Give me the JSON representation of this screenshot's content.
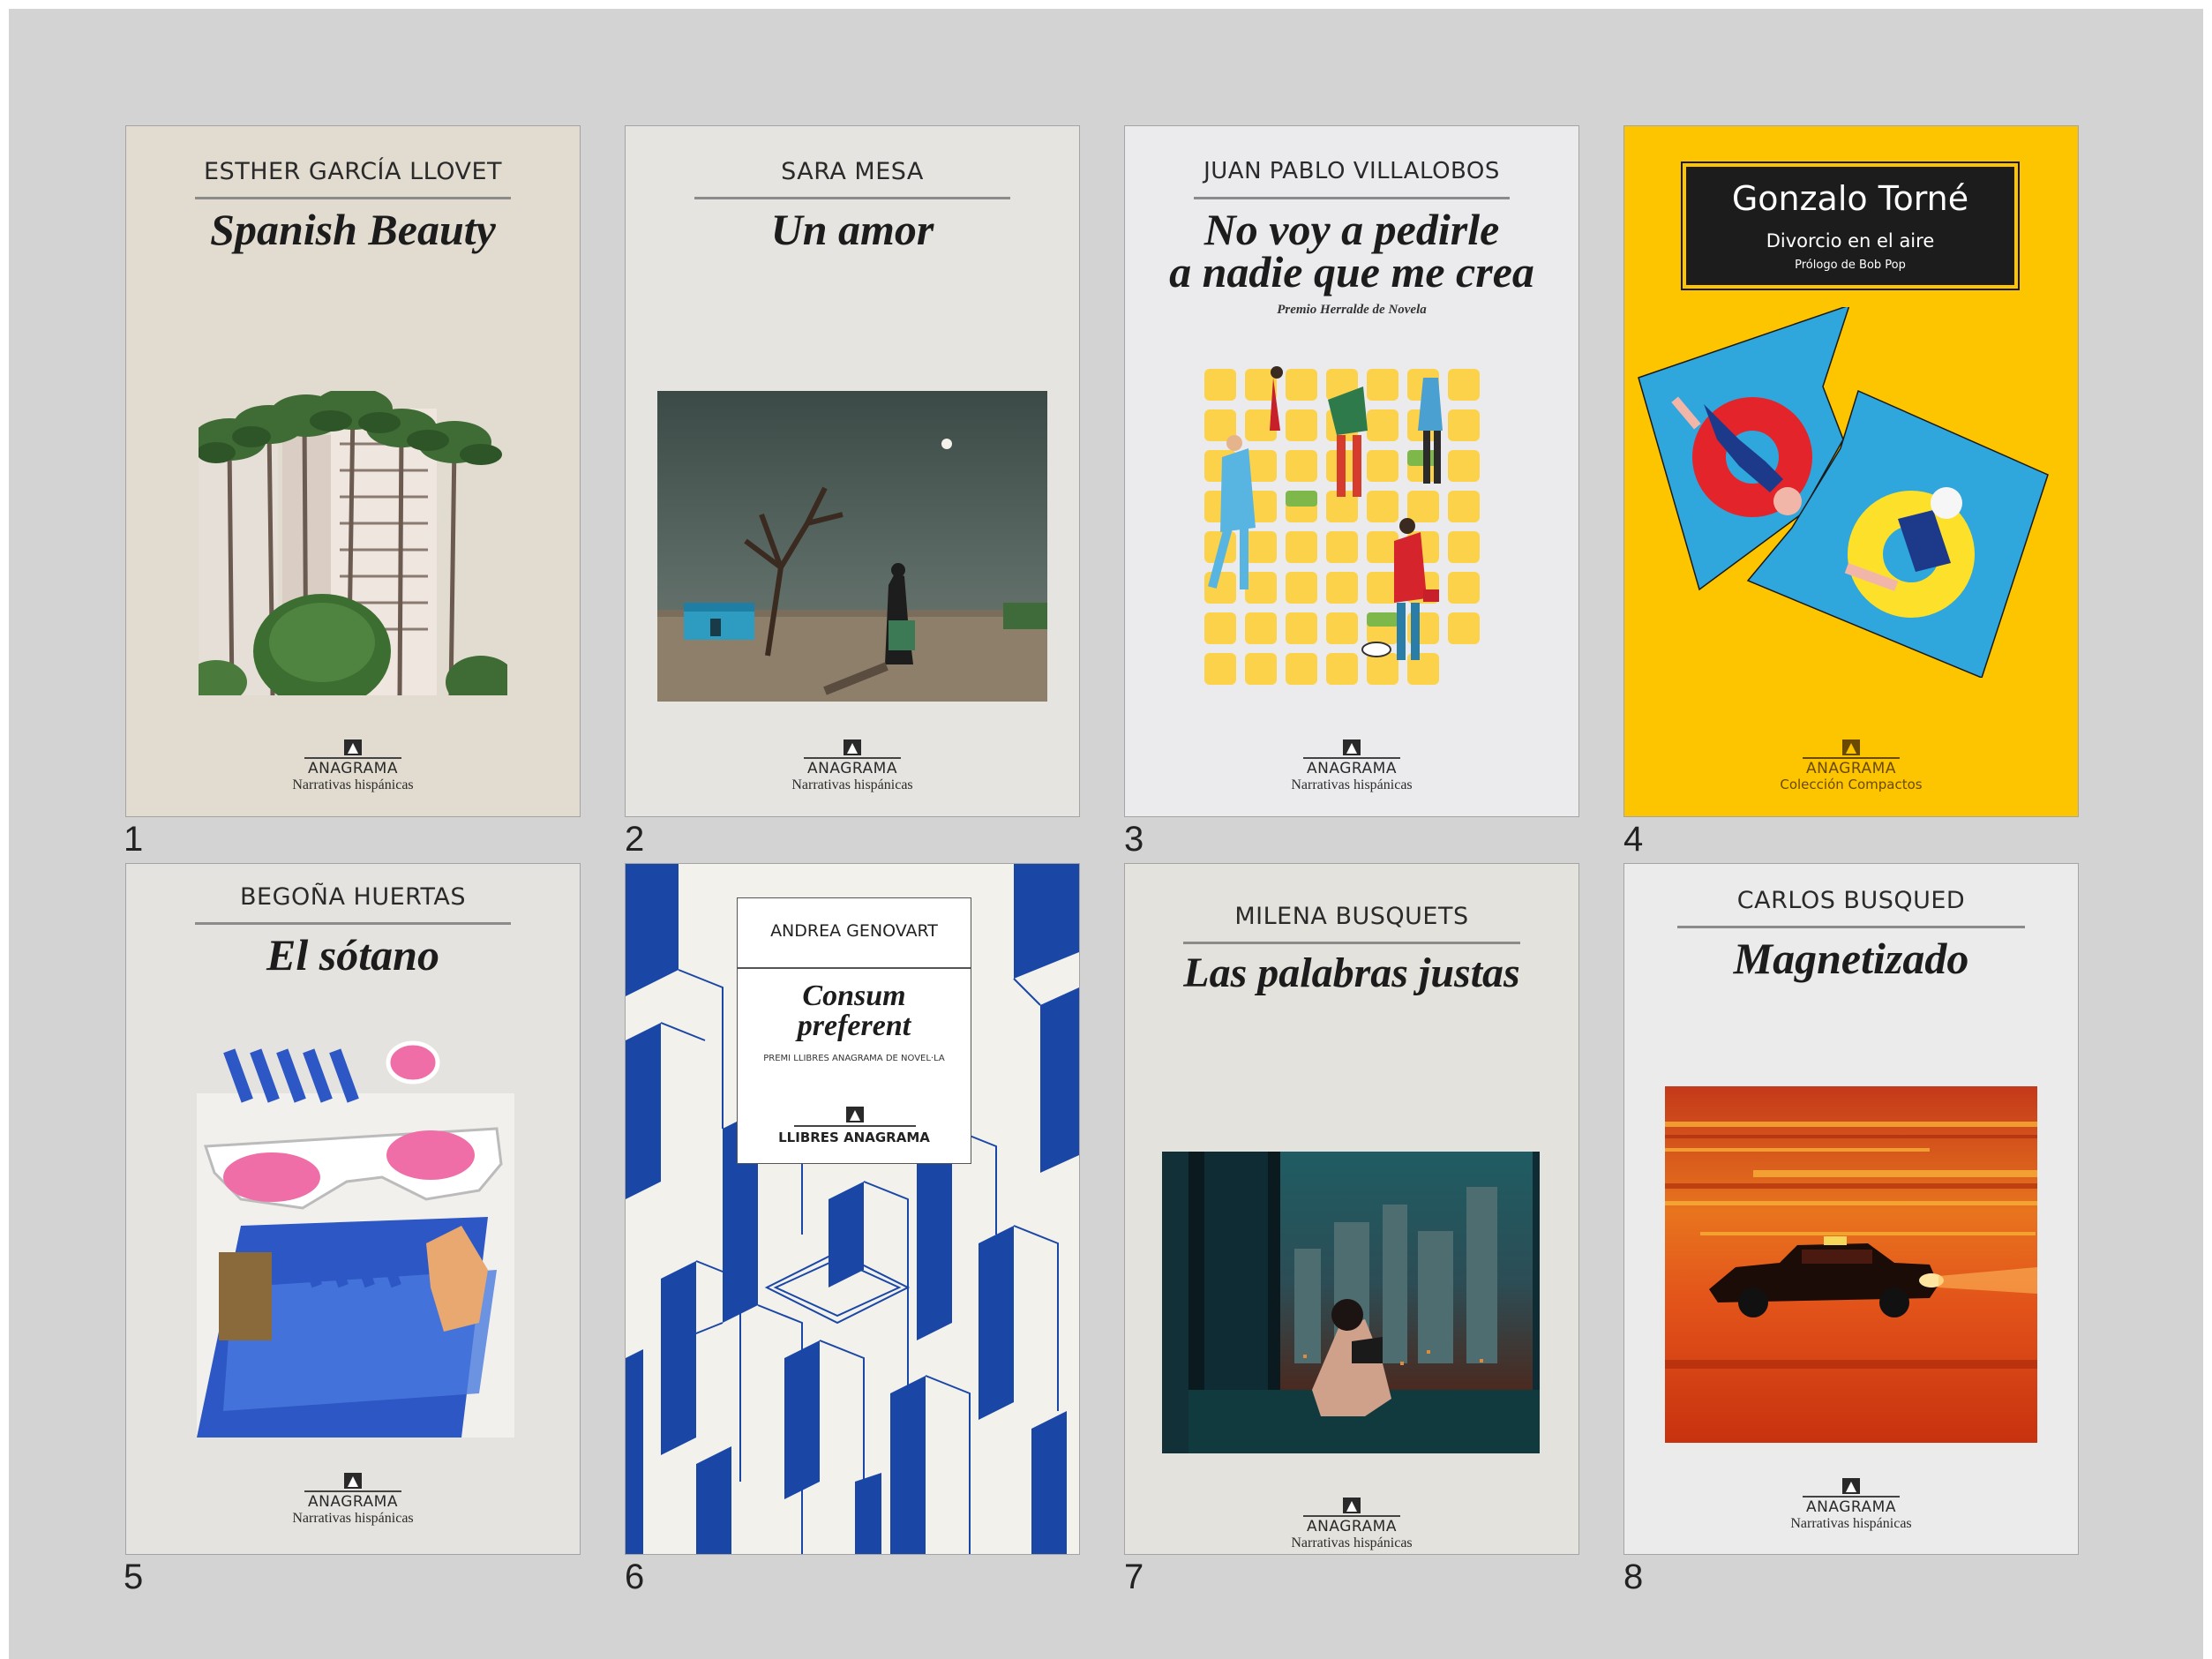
{
  "covers": [
    {
      "number": "1",
      "author": "ESTHER GARCÍA LLOVET",
      "title": "Spanish Beauty",
      "publisher": "ANAGRAMA",
      "collection": "Narrativas hispánicas",
      "bg": "#e2dbd0"
    },
    {
      "number": "2",
      "author": "SARA MESA",
      "title": "Un amor",
      "publisher": "ANAGRAMA",
      "collection": "Narrativas hispánicas",
      "bg": "#e6e4e0"
    },
    {
      "number": "3",
      "author": "JUAN PABLO VILLALOBOS",
      "title_line1": "No voy a pedirle",
      "title_line2": "a nadie que me crea",
      "note": "Premio Herralde de Novela",
      "publisher": "ANAGRAMA",
      "collection": "Narrativas hispánicas",
      "bg": "#ebebed"
    },
    {
      "number": "4",
      "author": "Gonzalo Torné",
      "title": "Divorcio en el aire",
      "note": "Prólogo de Bob Pop",
      "publisher": "ANAGRAMA",
      "collection": "Colección Compactos",
      "bg": "#fdc400"
    },
    {
      "number": "5",
      "author": "BEGOÑA HUERTAS",
      "title": "El sótano",
      "publisher": "ANAGRAMA",
      "collection": "Narrativas hispánicas",
      "bg": "#e5e3df"
    },
    {
      "number": "6",
      "author": "ANDREA GENOVART",
      "title_line1": "Consum",
      "title_line2": "preferent",
      "note": "PREMI LLIBRES ANAGRAMA DE NOVEL·LA",
      "publisher": "LLIBRES ANAGRAMA",
      "bg": "#f3f1ec"
    },
    {
      "number": "7",
      "author": "MILENA BUSQUETS",
      "title": "Las palabras justas",
      "publisher": "ANAGRAMA",
      "collection": "Narrativas hispánicas",
      "bg": "#e4e2dd"
    },
    {
      "number": "8",
      "author": "CARLOS BUSQUED",
      "title": "Magnetizado",
      "publisher": "ANAGRAMA",
      "collection": "Narrativas hispánicas",
      "bg": "#ebebeb"
    }
  ],
  "colors": {
    "panel": "#d3d3d3",
    "yellow": "#fdc400",
    "blue": "#1a47a6",
    "sky": "#2fa6dc",
    "orange": "#e2541a"
  },
  "icons": [
    "anagrama-logo-icon"
  ]
}
